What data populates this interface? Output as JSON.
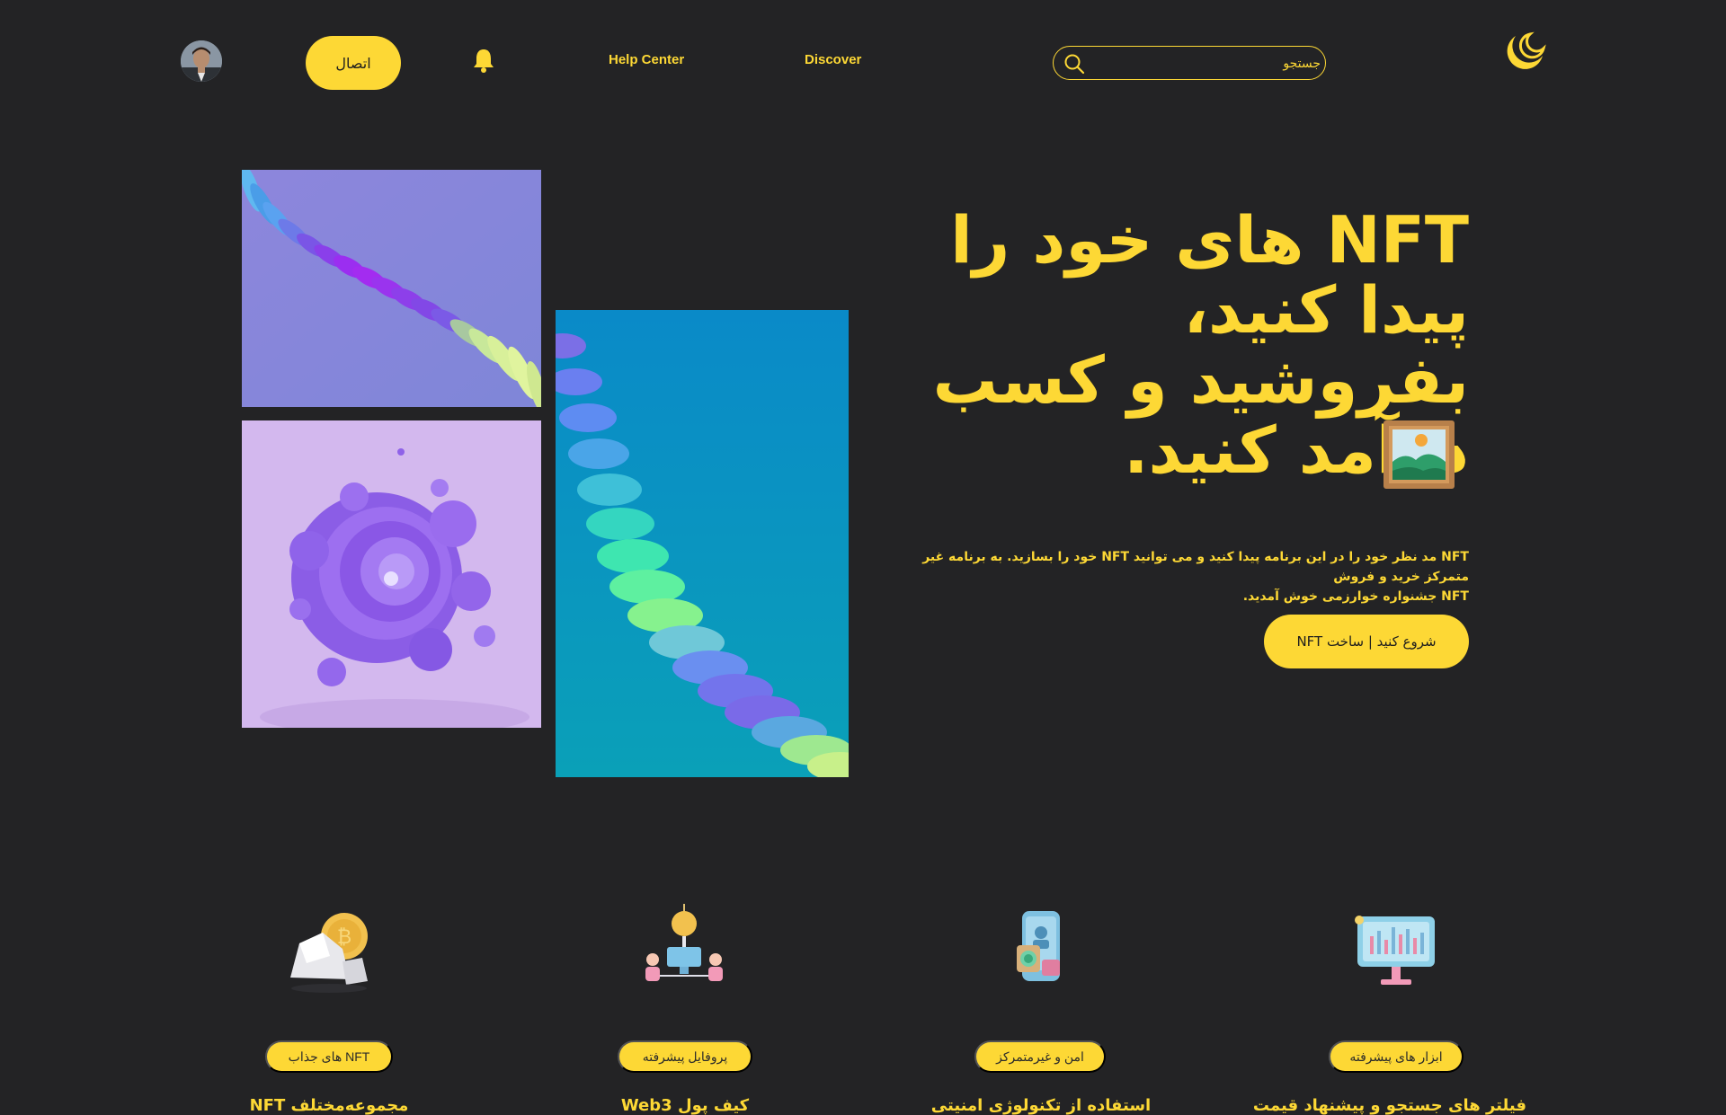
{
  "header": {
    "connect_label": "اتصال",
    "nav": {
      "help_center": "Help Center",
      "discover": "Discover"
    },
    "search": {
      "placeholder": "جستجو"
    }
  },
  "hero": {
    "title": "NFT های خود را پیدا کنید، بفروشید و کسب درآمد کنید.",
    "description_line1": "NFT مد نظر خود را در این برنامه پیدا کنید و می توانید NFT خود را بسازید. به برنامه غیر متمرکز خرید و فروش",
    "description_line2": "NFT جشنواره خوارزمی خوش آمدید.",
    "cta_label": "شروع کنید | ساخت NFT"
  },
  "features": [
    {
      "pill": "NFT های جذاب",
      "title": "مجموعه‌مختلف NFT",
      "icon": "coin-rock-icon"
    },
    {
      "pill": "پروفایل پیشرفته",
      "title": "کیف پول Web3",
      "icon": "network-coin-icon"
    },
    {
      "pill": "امن و غیرمتمرکز",
      "title": "استفاده از تکنولوژی امنیتی",
      "icon": "secure-wallet-icon"
    },
    {
      "pill": "ابزار های پیشرفته",
      "title": "فیلتر های جستجو و پیشنهاد قیمت",
      "icon": "chart-monitor-icon"
    }
  ],
  "colors": {
    "background": "#232325",
    "accent": "#fdd835",
    "button_text": "#1e1e1e"
  }
}
